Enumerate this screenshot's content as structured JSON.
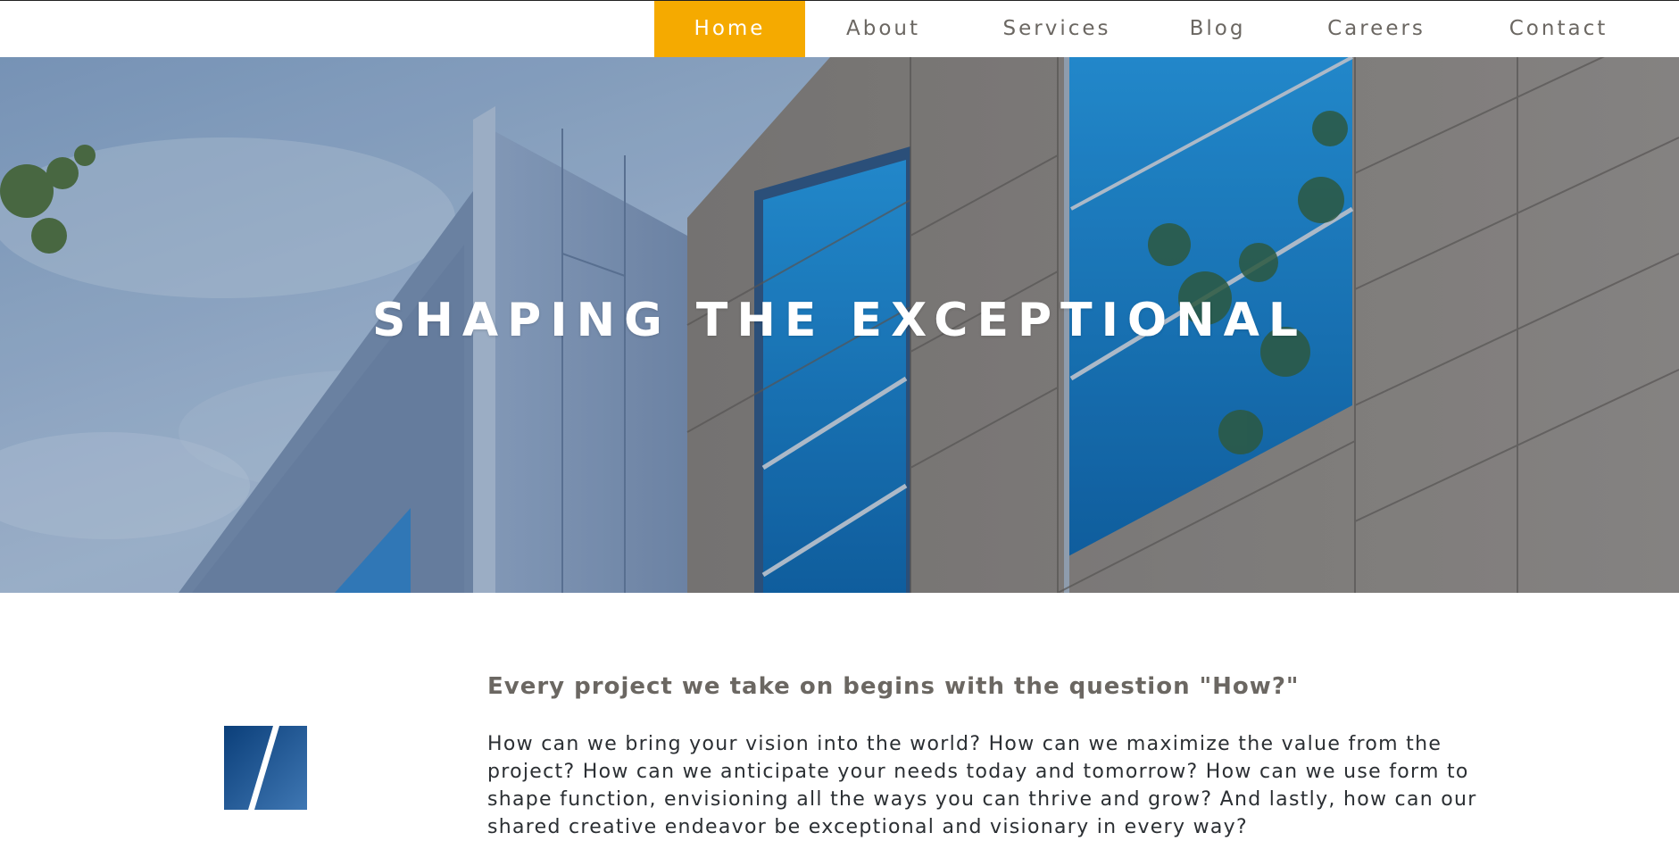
{
  "nav": {
    "items": [
      {
        "label": "Home",
        "active": true
      },
      {
        "label": "About",
        "active": false
      },
      {
        "label": "Services",
        "active": false
      },
      {
        "label": "Blog",
        "active": false
      },
      {
        "label": "Careers",
        "active": false
      },
      {
        "label": "Contact",
        "active": false
      }
    ],
    "active_color": "#f5aa00",
    "text_color": "#6b6762"
  },
  "hero": {
    "title": "SHAPING THE EXCEPTIONAL"
  },
  "content": {
    "heading": "Every project we take on begins with the question \"How?\"",
    "body": "How can we bring your vision into the world? How can we maximize the value from the project? How can we anticipate your needs today and tomorrow? How can we use form to shape function, envisioning all the ways you can thrive and grow? And lastly, how can our shared creative endeavor be exceptional and visionary in every way?"
  },
  "logo": {
    "icon": "logo-mark-icon",
    "color": "#0b3f7a"
  }
}
